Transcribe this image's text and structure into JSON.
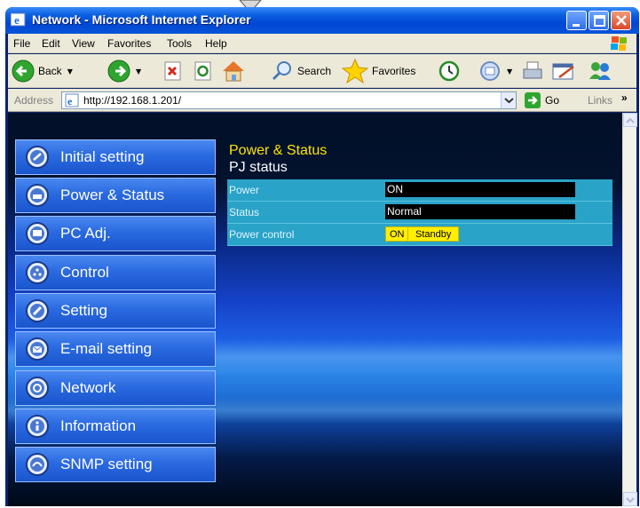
{
  "window": {
    "title": "Network - Microsoft Internet Explorer"
  },
  "menubar": {
    "items": [
      "File",
      "Edit",
      "View",
      "Favorites",
      "Tools",
      "Help"
    ]
  },
  "toolbar": {
    "back_label": "Back",
    "search_label": "Search",
    "favorites_label": "Favorites"
  },
  "addressbar": {
    "label": "Address",
    "url": "http://192.168.1.201/",
    "go_label": "Go",
    "links_label": "Links",
    "chevron": "»"
  },
  "nav": {
    "items": [
      {
        "label": "Initial setting",
        "icon": "setup-icon"
      },
      {
        "label": "Power & Status",
        "icon": "power-icon"
      },
      {
        "label": "PC Adj.",
        "icon": "monitor-icon"
      },
      {
        "label": "Control",
        "icon": "control-icon"
      },
      {
        "label": "Setting",
        "icon": "wrench-icon"
      },
      {
        "label": "E-mail setting",
        "icon": "envelope-icon"
      },
      {
        "label": "Network",
        "icon": "network-icon"
      },
      {
        "label": "Information",
        "icon": "info-icon"
      },
      {
        "label": "SNMP setting",
        "icon": "snmp-icon"
      }
    ]
  },
  "panel": {
    "heading": "Power & Status",
    "subheading": "PJ status",
    "rows": [
      {
        "key": "Power",
        "value": "ON"
      },
      {
        "key": "Status",
        "value": "Normal"
      }
    ],
    "power_control": {
      "key": "Power control",
      "on_label": "ON",
      "standby_label": "Standby"
    }
  },
  "colors": {
    "accent_yellow": "#ffe400",
    "nav_blue": "#2a6ae0",
    "table_cyan": "#2aa3c8"
  }
}
